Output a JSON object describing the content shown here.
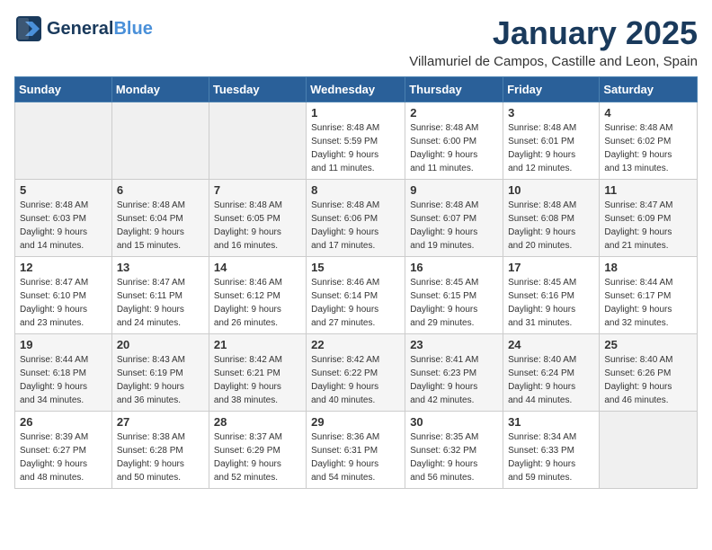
{
  "header": {
    "logo_general": "General",
    "logo_blue": "Blue",
    "month": "January 2025",
    "location": "Villamuriel de Campos, Castille and Leon, Spain"
  },
  "weekdays": [
    "Sunday",
    "Monday",
    "Tuesday",
    "Wednesday",
    "Thursday",
    "Friday",
    "Saturday"
  ],
  "weeks": [
    [
      {
        "day": "",
        "info": ""
      },
      {
        "day": "",
        "info": ""
      },
      {
        "day": "",
        "info": ""
      },
      {
        "day": "1",
        "info": "Sunrise: 8:48 AM\nSunset: 5:59 PM\nDaylight: 9 hours\nand 11 minutes."
      },
      {
        "day": "2",
        "info": "Sunrise: 8:48 AM\nSunset: 6:00 PM\nDaylight: 9 hours\nand 11 minutes."
      },
      {
        "day": "3",
        "info": "Sunrise: 8:48 AM\nSunset: 6:01 PM\nDaylight: 9 hours\nand 12 minutes."
      },
      {
        "day": "4",
        "info": "Sunrise: 8:48 AM\nSunset: 6:02 PM\nDaylight: 9 hours\nand 13 minutes."
      }
    ],
    [
      {
        "day": "5",
        "info": "Sunrise: 8:48 AM\nSunset: 6:03 PM\nDaylight: 9 hours\nand 14 minutes."
      },
      {
        "day": "6",
        "info": "Sunrise: 8:48 AM\nSunset: 6:04 PM\nDaylight: 9 hours\nand 15 minutes."
      },
      {
        "day": "7",
        "info": "Sunrise: 8:48 AM\nSunset: 6:05 PM\nDaylight: 9 hours\nand 16 minutes."
      },
      {
        "day": "8",
        "info": "Sunrise: 8:48 AM\nSunset: 6:06 PM\nDaylight: 9 hours\nand 17 minutes."
      },
      {
        "day": "9",
        "info": "Sunrise: 8:48 AM\nSunset: 6:07 PM\nDaylight: 9 hours\nand 19 minutes."
      },
      {
        "day": "10",
        "info": "Sunrise: 8:48 AM\nSunset: 6:08 PM\nDaylight: 9 hours\nand 20 minutes."
      },
      {
        "day": "11",
        "info": "Sunrise: 8:47 AM\nSunset: 6:09 PM\nDaylight: 9 hours\nand 21 minutes."
      }
    ],
    [
      {
        "day": "12",
        "info": "Sunrise: 8:47 AM\nSunset: 6:10 PM\nDaylight: 9 hours\nand 23 minutes."
      },
      {
        "day": "13",
        "info": "Sunrise: 8:47 AM\nSunset: 6:11 PM\nDaylight: 9 hours\nand 24 minutes."
      },
      {
        "day": "14",
        "info": "Sunrise: 8:46 AM\nSunset: 6:12 PM\nDaylight: 9 hours\nand 26 minutes."
      },
      {
        "day": "15",
        "info": "Sunrise: 8:46 AM\nSunset: 6:14 PM\nDaylight: 9 hours\nand 27 minutes."
      },
      {
        "day": "16",
        "info": "Sunrise: 8:45 AM\nSunset: 6:15 PM\nDaylight: 9 hours\nand 29 minutes."
      },
      {
        "day": "17",
        "info": "Sunrise: 8:45 AM\nSunset: 6:16 PM\nDaylight: 9 hours\nand 31 minutes."
      },
      {
        "day": "18",
        "info": "Sunrise: 8:44 AM\nSunset: 6:17 PM\nDaylight: 9 hours\nand 32 minutes."
      }
    ],
    [
      {
        "day": "19",
        "info": "Sunrise: 8:44 AM\nSunset: 6:18 PM\nDaylight: 9 hours\nand 34 minutes."
      },
      {
        "day": "20",
        "info": "Sunrise: 8:43 AM\nSunset: 6:19 PM\nDaylight: 9 hours\nand 36 minutes."
      },
      {
        "day": "21",
        "info": "Sunrise: 8:42 AM\nSunset: 6:21 PM\nDaylight: 9 hours\nand 38 minutes."
      },
      {
        "day": "22",
        "info": "Sunrise: 8:42 AM\nSunset: 6:22 PM\nDaylight: 9 hours\nand 40 minutes."
      },
      {
        "day": "23",
        "info": "Sunrise: 8:41 AM\nSunset: 6:23 PM\nDaylight: 9 hours\nand 42 minutes."
      },
      {
        "day": "24",
        "info": "Sunrise: 8:40 AM\nSunset: 6:24 PM\nDaylight: 9 hours\nand 44 minutes."
      },
      {
        "day": "25",
        "info": "Sunrise: 8:40 AM\nSunset: 6:26 PM\nDaylight: 9 hours\nand 46 minutes."
      }
    ],
    [
      {
        "day": "26",
        "info": "Sunrise: 8:39 AM\nSunset: 6:27 PM\nDaylight: 9 hours\nand 48 minutes."
      },
      {
        "day": "27",
        "info": "Sunrise: 8:38 AM\nSunset: 6:28 PM\nDaylight: 9 hours\nand 50 minutes."
      },
      {
        "day": "28",
        "info": "Sunrise: 8:37 AM\nSunset: 6:29 PM\nDaylight: 9 hours\nand 52 minutes."
      },
      {
        "day": "29",
        "info": "Sunrise: 8:36 AM\nSunset: 6:31 PM\nDaylight: 9 hours\nand 54 minutes."
      },
      {
        "day": "30",
        "info": "Sunrise: 8:35 AM\nSunset: 6:32 PM\nDaylight: 9 hours\nand 56 minutes."
      },
      {
        "day": "31",
        "info": "Sunrise: 8:34 AM\nSunset: 6:33 PM\nDaylight: 9 hours\nand 59 minutes."
      },
      {
        "day": "",
        "info": ""
      }
    ]
  ]
}
